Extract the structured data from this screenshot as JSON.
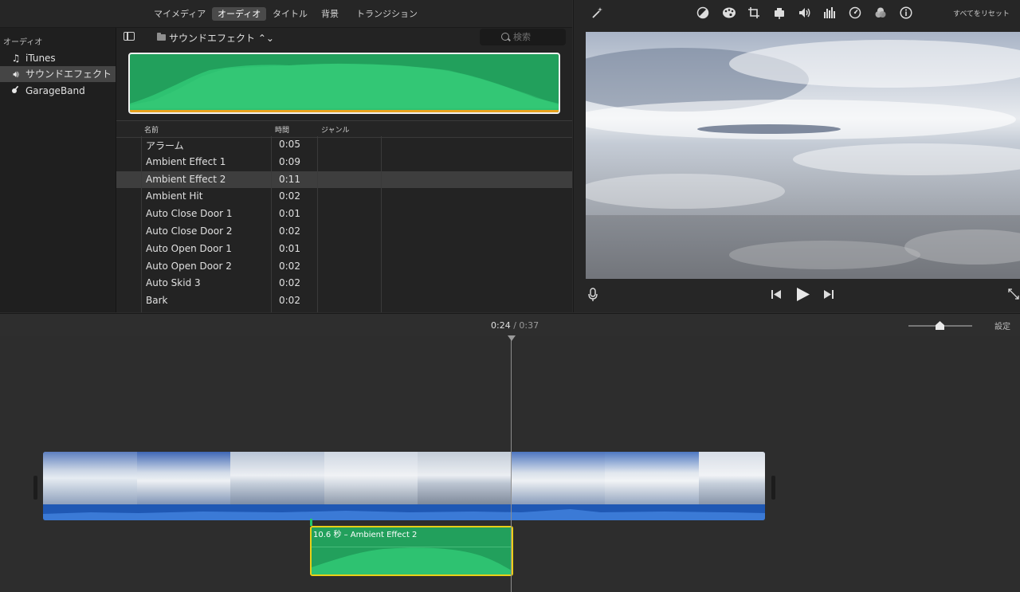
{
  "tabs": [
    {
      "label": "マイメディア",
      "active": false
    },
    {
      "label": "オーディオ",
      "active": true
    },
    {
      "label": "タイトル",
      "active": false
    },
    {
      "label": "背景",
      "active": false
    },
    {
      "label": "トランジション",
      "active": false
    }
  ],
  "sidebar": {
    "heading": "オーディオ",
    "items": [
      {
        "label": "iTunes",
        "icon": "music-note-icon",
        "selected": false
      },
      {
        "label": "サウンドエフェクト",
        "icon": "speaker-icon",
        "selected": true
      },
      {
        "label": "GarageBand",
        "icon": "guitar-icon",
        "selected": false
      }
    ]
  },
  "browser": {
    "folder_label": "サウンドエフェクト ⌃⌄",
    "search_placeholder": "検索",
    "columns": {
      "name": "名前",
      "duration": "時間",
      "genre": "ジャンル"
    },
    "rows": [
      {
        "name": "アラーム",
        "duration": "0:05",
        "selected": false
      },
      {
        "name": "Ambient Effect 1",
        "duration": "0:09",
        "selected": false
      },
      {
        "name": "Ambient Effect 2",
        "duration": "0:11",
        "selected": true
      },
      {
        "name": "Ambient Hit",
        "duration": "0:02",
        "selected": false
      },
      {
        "name": "Auto Close Door 1",
        "duration": "0:01",
        "selected": false
      },
      {
        "name": "Auto Close Door 2",
        "duration": "0:02",
        "selected": false
      },
      {
        "name": "Auto Open Door 1",
        "duration": "0:01",
        "selected": false
      },
      {
        "name": "Auto Open Door 2",
        "duration": "0:02",
        "selected": false
      },
      {
        "name": "Auto Skid 3",
        "duration": "0:02",
        "selected": false
      },
      {
        "name": "Bark",
        "duration": "0:02",
        "selected": false
      }
    ]
  },
  "viewer": {
    "reset_label": "すべてをリセット",
    "toolbar_icons": [
      "magic-wand-icon",
      "color-balance-icon",
      "color-palette-icon",
      "crop-icon",
      "stabilize-camera-icon",
      "volume-icon",
      "equalizer-icon",
      "speed-icon",
      "filter-icon",
      "info-icon"
    ]
  },
  "timeline": {
    "current_time": "0:24",
    "separator": "/",
    "total_time": "0:37",
    "settings_label": "設定",
    "zoom_level": 0.5,
    "audio_clip_label": "10.6 秒 – Ambient Effect 2"
  },
  "colors": {
    "audio_green": "#22a05c",
    "audio_border": "#e9cf18",
    "video_audio_blue": "#1f58b4",
    "preview_bottom": "#e6a11e"
  }
}
